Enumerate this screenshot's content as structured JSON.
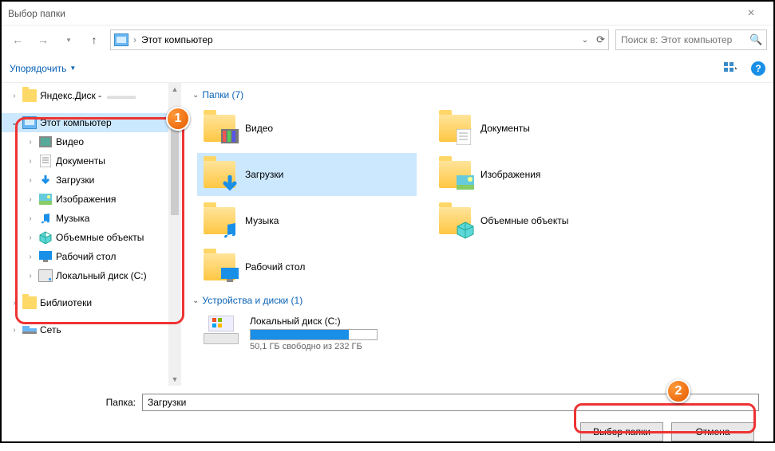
{
  "title": "Выбор папки",
  "nav": {
    "location": "Этот компьютер",
    "search_placeholder": "Поиск в: Этот компьютер"
  },
  "toolbar": {
    "organize": "Упорядочить"
  },
  "tree": {
    "yandex": "Яндекс.Диск -",
    "this_pc": "Этот компьютер",
    "items": [
      {
        "label": "Видео"
      },
      {
        "label": "Документы"
      },
      {
        "label": "Загрузки"
      },
      {
        "label": "Изображения"
      },
      {
        "label": "Музыка"
      },
      {
        "label": "Объемные объекты"
      },
      {
        "label": "Рабочий стол"
      },
      {
        "label": "Локальный диск (C:)"
      }
    ],
    "libraries": "Библиотеки",
    "network": "Сеть"
  },
  "sections": {
    "folders": "Папки (7)",
    "drives": "Устройства и диски (1)"
  },
  "folders": [
    {
      "label": "Видео"
    },
    {
      "label": "Документы"
    },
    {
      "label": "Загрузки"
    },
    {
      "label": "Изображения"
    },
    {
      "label": "Музыка"
    },
    {
      "label": "Объемные объекты"
    },
    {
      "label": "Рабочий стол"
    }
  ],
  "drive": {
    "name": "Локальный диск (C:)",
    "free": "50,1 ГБ свободно из 232 ГБ"
  },
  "footer": {
    "label": "Папка:",
    "value": "Загрузки",
    "select": "Выбор папки",
    "cancel": "Отмена"
  }
}
